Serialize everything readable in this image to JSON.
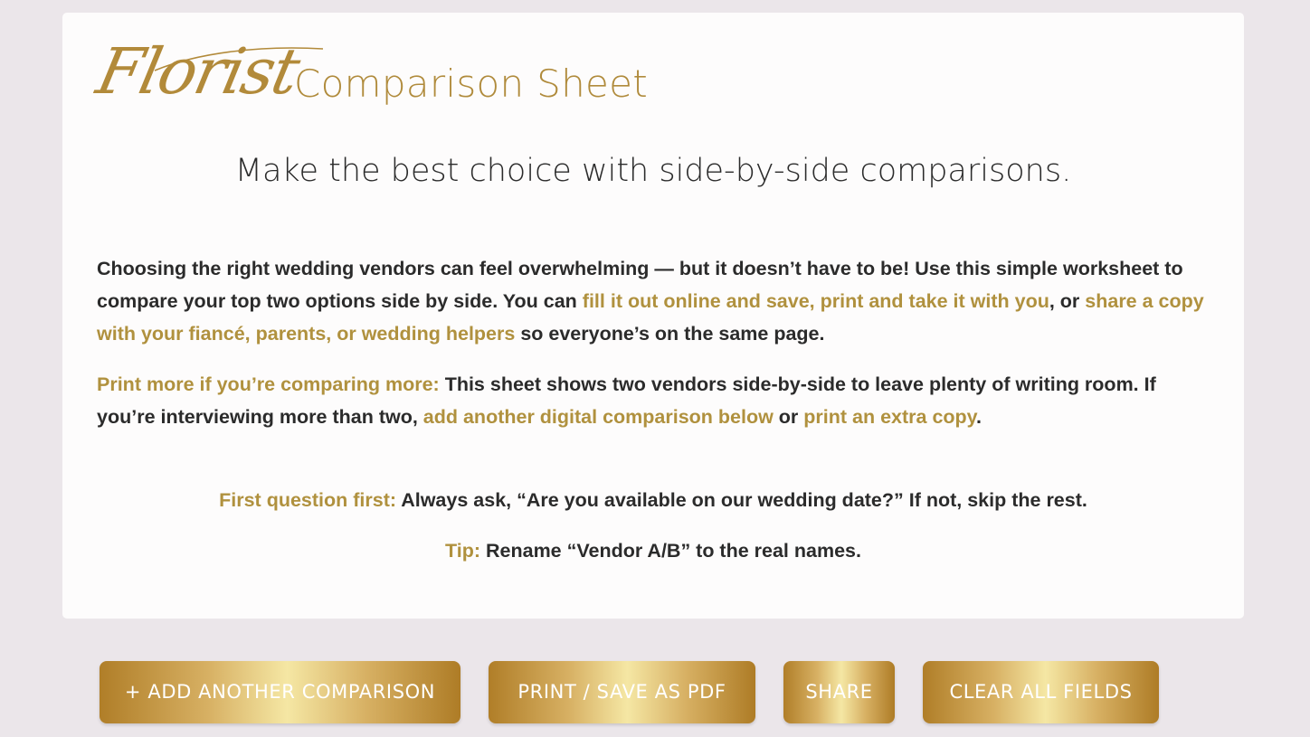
{
  "header": {
    "script_word": "Florist",
    "title": "Comparison Sheet"
  },
  "subtitle": "Make the best choice with side-by-side comparisons.",
  "intro": {
    "text_1": "Choosing the right wedding vendors can feel overwhelming — but it doesn’t have to be! Use this simple worksheet to compare your top two options side by side. You can ",
    "link_1": "fill it out online and save, print and take it with you",
    "text_2": ", or ",
    "link_2": "share a copy with your fiancé, parents, or wedding helpers",
    "text_3": " so everyone’s on the same page."
  },
  "print_more": {
    "label": "Print more if you’re comparing more:",
    "text_1": " This sheet shows two vendors side-by-side to leave plenty of writing room. If you’re interviewing more than two, ",
    "link_1": "add another digital comparison below",
    "text_2": " or ",
    "link_2": "print an extra copy",
    "text_3": "."
  },
  "first_question": {
    "label": "First question first:",
    "text": " Always ask, “Are you available on our wedding date?” If not, skip the rest."
  },
  "tip": {
    "label": "Tip:",
    "text": " Rename “Vendor A/B” to the real names."
  },
  "buttons": {
    "add_comparison": "+ ADD ANOTHER COMPARISON",
    "print_pdf": "PRINT / SAVE AS PDF",
    "share": "SHARE",
    "clear_all": "CLEAR ALL FIELDS"
  },
  "colors": {
    "page_background": "#ebe6ea",
    "card_background": "#fdfcfc",
    "accent_gold": "#b0913e",
    "text_dark": "#2b2b2b"
  }
}
